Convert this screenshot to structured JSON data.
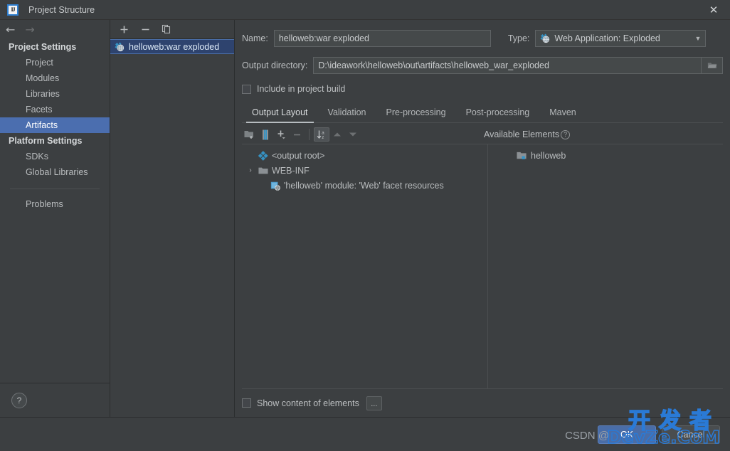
{
  "window": {
    "title": "Project Structure",
    "logo_text": "IJ",
    "close_label": "✕"
  },
  "nav": {
    "back": "←",
    "forward": "→"
  },
  "sidebar": {
    "groups": [
      {
        "label": "Project Settings",
        "items": [
          {
            "label": "Project",
            "selected": false
          },
          {
            "label": "Modules",
            "selected": false
          },
          {
            "label": "Libraries",
            "selected": false
          },
          {
            "label": "Facets",
            "selected": false
          },
          {
            "label": "Artifacts",
            "selected": true
          }
        ]
      },
      {
        "label": "Platform Settings",
        "items": [
          {
            "label": "SDKs",
            "selected": false
          },
          {
            "label": "Global Libraries",
            "selected": false
          }
        ]
      }
    ],
    "problems": "Problems",
    "help_label": "?"
  },
  "artifact_panel": {
    "toolbar": [
      {
        "name": "add-artifact-button",
        "glyph": "+"
      },
      {
        "name": "remove-artifact-button",
        "glyph": "−"
      },
      {
        "name": "copy-artifact-button",
        "glyph": "❐"
      }
    ],
    "items": [
      {
        "label": "helloweb:war exploded",
        "selected": true
      }
    ]
  },
  "detail": {
    "name_label": "Name:",
    "name_value": "helloweb:war exploded",
    "type_label": "Type:",
    "type_value": "Web Application: Exploded",
    "output_dir_label": "Output directory:",
    "output_dir_value": "D:\\ideawork\\helloweb\\out\\artifacts\\helloweb_war_exploded",
    "include_in_build_label": "Include in project build",
    "include_in_build_checked": false,
    "tabs": [
      {
        "label": "Output Layout",
        "active": true
      },
      {
        "label": "Validation",
        "active": false
      },
      {
        "label": "Pre-processing",
        "active": false
      },
      {
        "label": "Post-processing",
        "active": false
      },
      {
        "label": "Maven",
        "active": false
      }
    ],
    "layout_toolbar": [
      {
        "name": "create-directory-button",
        "pressed": false,
        "enabled": true
      },
      {
        "name": "create-archive-button",
        "pressed": false,
        "enabled": true
      },
      {
        "name": "add-copy-button",
        "pressed": false,
        "enabled": true
      },
      {
        "name": "remove-element-button",
        "pressed": false,
        "enabled": false
      },
      {
        "name": "sort-elements-button",
        "pressed": true,
        "enabled": true
      },
      {
        "name": "move-up-button",
        "pressed": false,
        "enabled": false
      },
      {
        "name": "move-down-button",
        "pressed": false,
        "enabled": false
      }
    ],
    "available_elements_label": "Available Elements",
    "available_elements_help": "?",
    "tree": [
      {
        "label": "<output root>",
        "icon": "artifact-root-icon",
        "indent": 0,
        "twisty": ""
      },
      {
        "label": "WEB-INF",
        "icon": "folder-icon",
        "indent": 0,
        "twisty": "›"
      },
      {
        "label": "'helloweb' module: 'Web' facet resources",
        "icon": "facet-resources-icon",
        "indent": 1,
        "twisty": ""
      }
    ],
    "available": [
      {
        "label": "helloweb",
        "icon": "module-icon"
      }
    ],
    "show_content_label": "Show content of elements",
    "show_content_checked": false,
    "more_button_label": "..."
  },
  "footer": {
    "ok_label": "OK",
    "cancel_label": "Cancel"
  },
  "watermark": {
    "cn": "开发者",
    "en": "DevZe.CoM",
    "csdn": "CSDN @"
  },
  "colors": {
    "background": "#3c3f41",
    "selection_blue": "#4b6eaf",
    "list_selection": "#2e436e",
    "accent_cyan": "#3592c4",
    "text": "#b9bcbe",
    "watermark_blue": "#2a7ad6"
  }
}
